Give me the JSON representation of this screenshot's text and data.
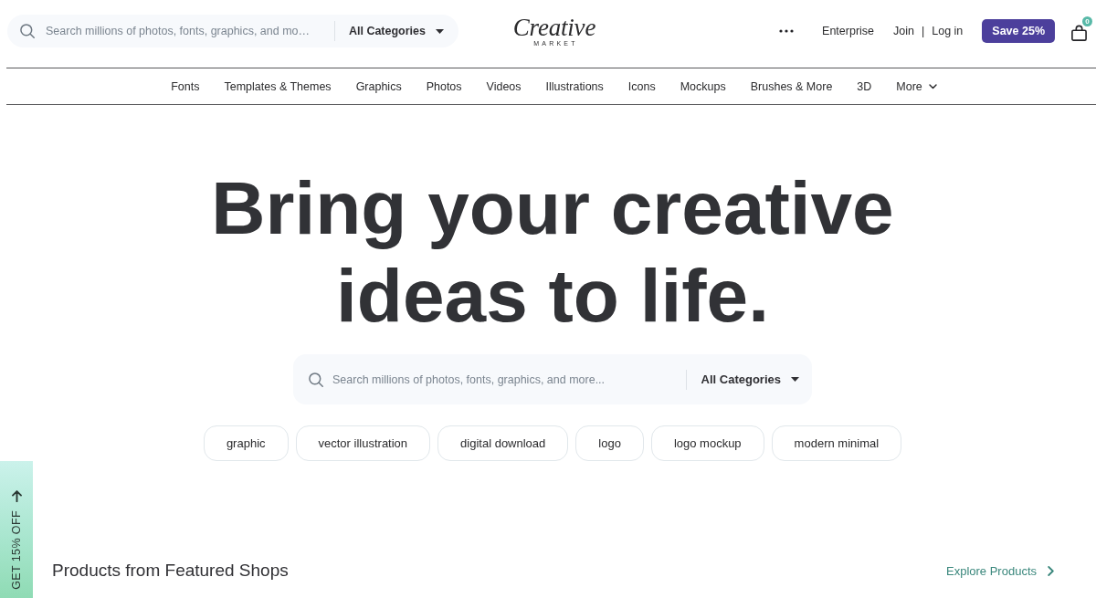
{
  "header": {
    "search": {
      "placeholder": "Search millions of photos, fonts, graphics, and mo…",
      "category": "All Categories"
    },
    "logo": {
      "wordmark": "Creative",
      "subtitle": "MARKET"
    },
    "enterprise_link": "Enterprise",
    "account": {
      "join": "Join",
      "separator": "|",
      "login": "Log in"
    },
    "promo_button": "Save 25%",
    "cart_count": "0"
  },
  "nav": {
    "items": [
      "Fonts",
      "Templates & Themes",
      "Graphics",
      "Photos",
      "Videos",
      "Illustrations",
      "Icons",
      "Mockups",
      "Brushes & More",
      "3D"
    ],
    "more": "More"
  },
  "hero": {
    "title": "Bring your creative ideas to life.",
    "search": {
      "placeholder": "Search millions of photos, fonts, graphics, and more...",
      "category": "All Categories"
    },
    "tags": [
      "graphic",
      "vector illustration",
      "digital download",
      "logo",
      "logo mockup",
      "modern minimal"
    ]
  },
  "side_tab": {
    "label": "GET 15% OFF"
  },
  "featured": {
    "title": "Products from Featured Shops",
    "link": "Explore Products"
  }
}
